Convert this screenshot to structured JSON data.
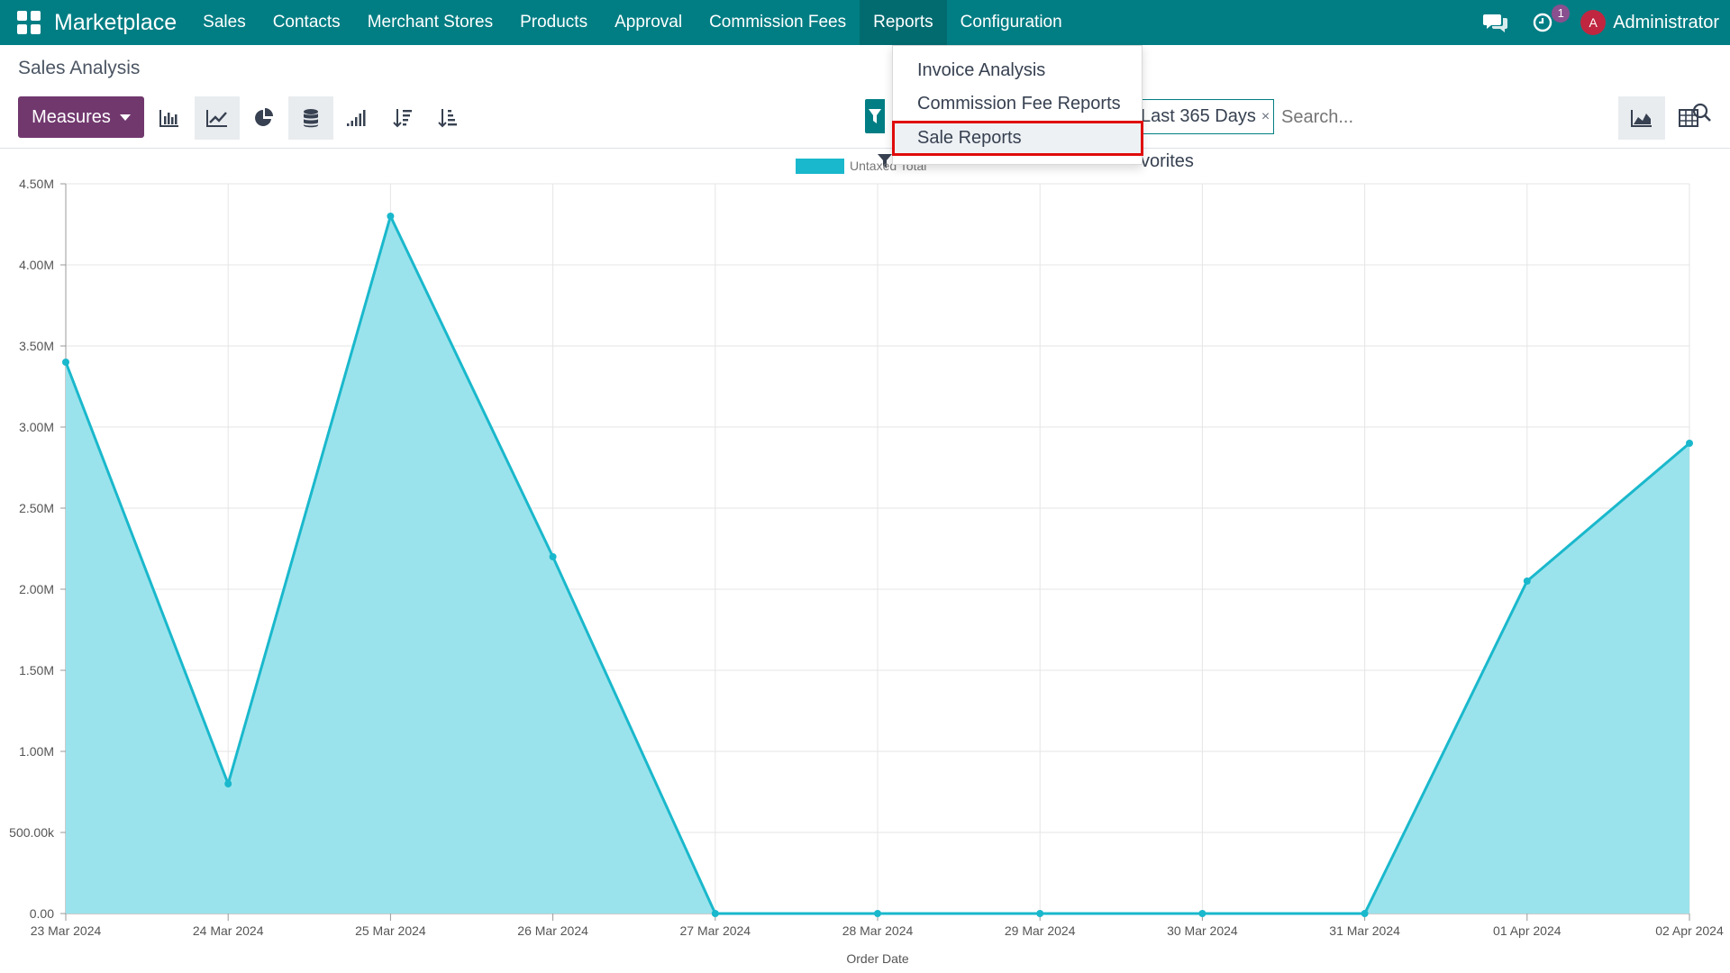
{
  "navbar": {
    "brand": "Marketplace",
    "menu": [
      "Sales",
      "Contacts",
      "Merchant Stores",
      "Products",
      "Approval",
      "Commission Fees",
      "Reports",
      "Configuration"
    ],
    "activity_badge": "1",
    "avatar_letter": "A",
    "user_name": "Administrator"
  },
  "control_panel": {
    "title": "Sales Analysis",
    "measures_label": "Measures",
    "facet_value": "Last 365 Days",
    "facet_remove": "×",
    "search_placeholder": "Search...",
    "favorites_partial": "vorites"
  },
  "reports_dropdown": {
    "items": [
      "Invoice Analysis",
      "Commission Fee Reports",
      "Sale Reports"
    ],
    "selected": "Sale Reports"
  },
  "colors": {
    "navbar": "#017e84",
    "measures": "#71386e",
    "series_line": "#1ab8cc",
    "series_fill": "#9be3ec",
    "highlight": "#e00b0b"
  },
  "chart_data": {
    "type": "area",
    "legend": "Untaxed Total",
    "xlabel": "Order Date",
    "categories": [
      "23 Mar 2024",
      "24 Mar 2024",
      "25 Mar 2024",
      "26 Mar 2024",
      "27 Mar 2024",
      "28 Mar 2024",
      "29 Mar 2024",
      "30 Mar 2024",
      "31 Mar 2024",
      "01 Apr 2024",
      "02 Apr 2024"
    ],
    "series": [
      {
        "name": "Untaxed Total",
        "values": [
          3400000,
          800000,
          4300000,
          2200000,
          0,
          0,
          0,
          0,
          0,
          2050000,
          2900000
        ]
      }
    ],
    "ylim": [
      0,
      4500000
    ],
    "yticks": [
      "0.00",
      "500.00k",
      "1.00M",
      "1.50M",
      "2.00M",
      "2.50M",
      "3.00M",
      "3.50M",
      "4.00M",
      "4.50M"
    ],
    "grid": true,
    "legend_position": "top-center"
  }
}
